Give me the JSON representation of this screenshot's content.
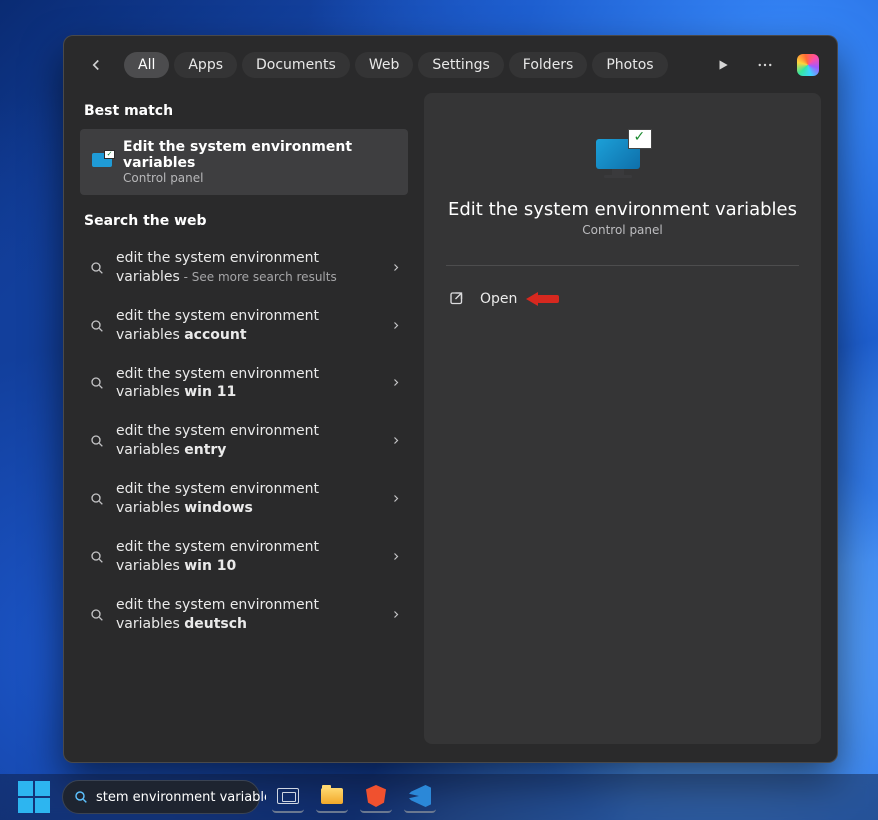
{
  "tabs": [
    "All",
    "Apps",
    "Documents",
    "Web",
    "Settings",
    "Folders",
    "Photos"
  ],
  "active_tab_index": 0,
  "sections": {
    "best_match": "Best match",
    "search_web": "Search the web"
  },
  "best_match": {
    "title": "Edit the system environment variables",
    "subtitle": "Control panel"
  },
  "web_results": [
    {
      "prefix": "edit the system environment variables",
      "bold": "",
      "more": "See more search results"
    },
    {
      "prefix": "edit the system environment variables ",
      "bold": "account",
      "more": ""
    },
    {
      "prefix": "edit the system environment variables ",
      "bold": "win 11",
      "more": ""
    },
    {
      "prefix": "edit the system environment variables ",
      "bold": "entry",
      "more": ""
    },
    {
      "prefix": "edit the system environment variables ",
      "bold": "windows",
      "more": ""
    },
    {
      "prefix": "edit the system environment variables ",
      "bold": "win 10",
      "more": ""
    },
    {
      "prefix": "edit the system environment variables ",
      "bold": "deutsch",
      "more": ""
    }
  ],
  "detail": {
    "title": "Edit the system environment variables",
    "subtitle": "Control panel",
    "open": "Open"
  },
  "taskbar": {
    "search_value": "stem environment variables"
  }
}
